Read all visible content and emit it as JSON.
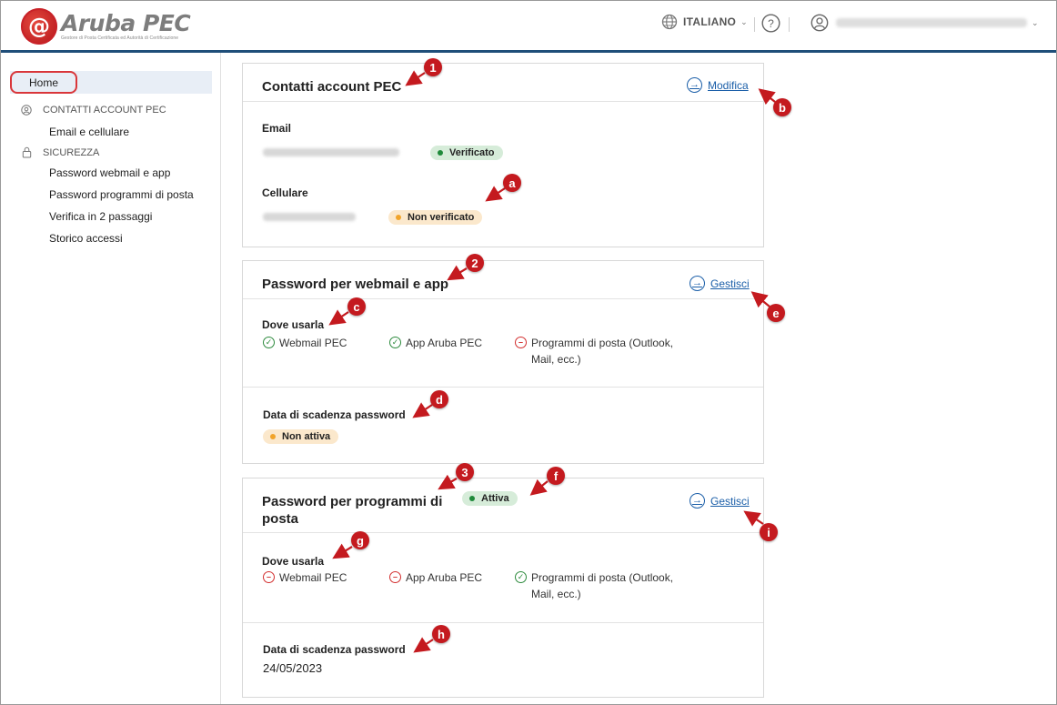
{
  "header": {
    "logo_mark": "@",
    "logo_title": "Aruba PEC",
    "logo_subtitle": "Gestore di Posta Certificata ed Autorità di Certificazione",
    "language": "ITALIANO",
    "help_symbol": "?",
    "icons": {
      "language": "globe-icon",
      "help": "help-icon",
      "user": "user-icon",
      "chevron": "chevron-down-icon"
    }
  },
  "sidebar": {
    "home": "Home",
    "sections": [
      {
        "label": "CONTATTI ACCOUNT PEC",
        "icon": "user-circle-icon",
        "items": [
          "Email e cellulare"
        ]
      },
      {
        "label": "SICUREZZA",
        "icon": "lock-icon",
        "items": [
          "Password webmail e app",
          "Password programmi di posta",
          "Verifica in 2 passaggi",
          "Storico accessi"
        ]
      }
    ]
  },
  "contacts": {
    "title": "Contatti account PEC",
    "action": "Modifica",
    "email_label": "Email",
    "email_status": "Verificato",
    "phone_label": "Cellulare",
    "phone_status": "Non verificato"
  },
  "webmail_password": {
    "title": "Password per webmail e app",
    "action": "Gestisci",
    "where_label": "Dove usarla",
    "uses": [
      {
        "label": "Webmail PEC",
        "allowed": true
      },
      {
        "label": "App Aruba PEC",
        "allowed": true
      },
      {
        "label": "Programmi di posta (Outlook, Mail, ecc.)",
        "allowed": false
      }
    ],
    "expiry_label": "Data di scadenza password",
    "expiry_status": "Non attiva"
  },
  "client_password": {
    "title": "Password per programmi di posta",
    "status": "Attiva",
    "action": "Gestisci",
    "where_label": "Dove usarla",
    "uses": [
      {
        "label": "Webmail PEC",
        "allowed": false
      },
      {
        "label": "App Aruba PEC",
        "allowed": false
      },
      {
        "label": "Programmi di posta (Outlook, Mail, ecc.)",
        "allowed": true
      }
    ],
    "expiry_label": "Data di scadenza password",
    "expiry_value": "24/05/2023"
  },
  "annotations": [
    "1",
    "2",
    "3",
    "a",
    "b",
    "c",
    "d",
    "e",
    "f",
    "g",
    "h",
    "i"
  ],
  "colors": {
    "accent": "#1f4e79",
    "link": "#1a5ea8",
    "annotation": "#c41a1f",
    "ok": "#2e8b3e",
    "no": "#d32f2f"
  }
}
